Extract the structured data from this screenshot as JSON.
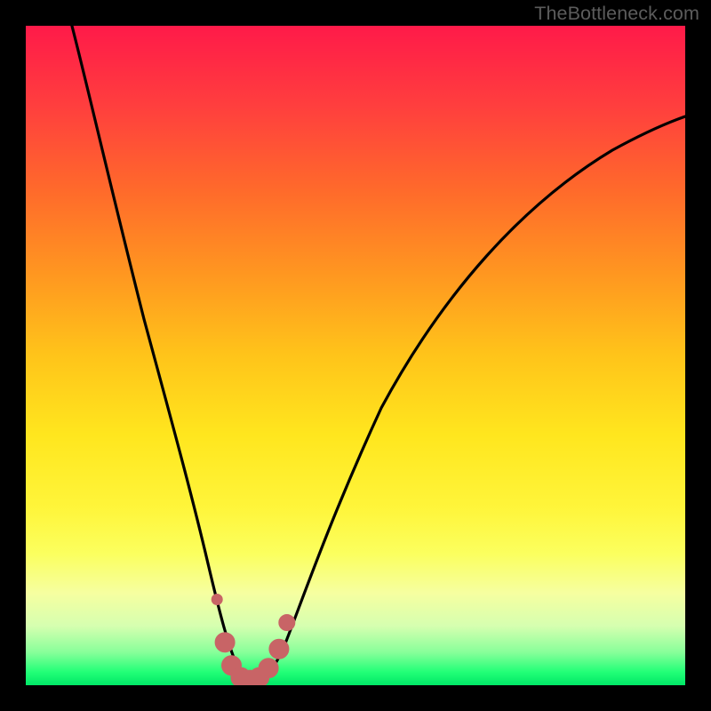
{
  "attribution": "TheBottleneck.com",
  "colors": {
    "frame": "#000000",
    "curve_stroke": "#000000",
    "marker_fill": "#c86466",
    "marker_stroke": "#c86466"
  },
  "chart_data": {
    "type": "line",
    "title": "",
    "xlabel": "",
    "ylabel": "",
    "xlim": [
      0,
      100
    ],
    "ylim": [
      0,
      100
    ],
    "series": [
      {
        "name": "bottleneck-curve",
        "x": [
          7,
          10,
          14,
          18,
          22,
          25,
          27,
          29,
          30.5,
          32,
          33.5,
          35,
          37,
          39,
          42,
          47,
          55,
          65,
          78,
          92,
          100
        ],
        "y": [
          100,
          88,
          73,
          58,
          43,
          31,
          22,
          13,
          6,
          2,
          0.5,
          0.5,
          2,
          6,
          14,
          26,
          42,
          56,
          68,
          77,
          81
        ]
      }
    ],
    "markers": [
      {
        "x": 29.0,
        "y": 13.0,
        "r": 6
      },
      {
        "x": 30.2,
        "y": 6.5,
        "r": 11
      },
      {
        "x": 31.2,
        "y": 3.0,
        "r": 11
      },
      {
        "x": 32.6,
        "y": 1.2,
        "r": 11
      },
      {
        "x": 34.0,
        "y": 0.8,
        "r": 11
      },
      {
        "x": 35.4,
        "y": 1.2,
        "r": 11
      },
      {
        "x": 36.8,
        "y": 2.6,
        "r": 11
      },
      {
        "x": 38.4,
        "y": 5.5,
        "r": 11
      },
      {
        "x": 39.6,
        "y": 9.5,
        "r": 9
      }
    ]
  }
}
